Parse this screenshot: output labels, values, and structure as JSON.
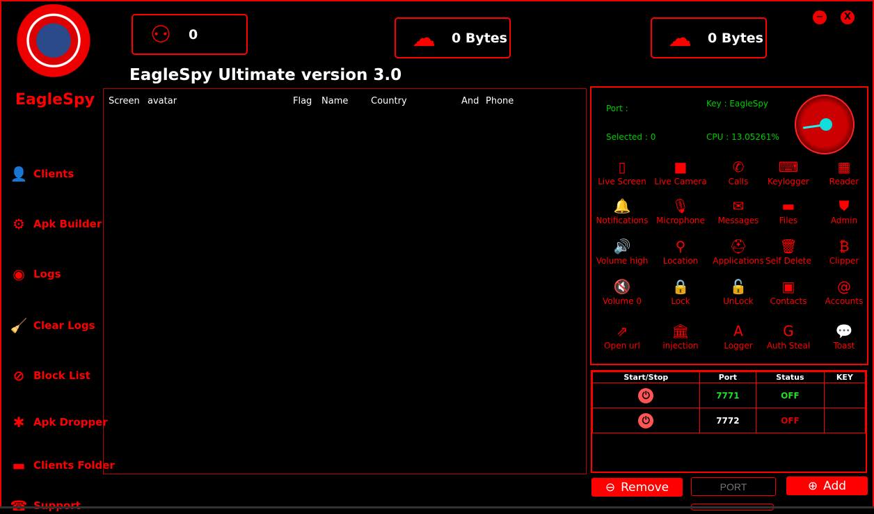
{
  "app": {
    "brand": "EagleSpy",
    "title": "EagleSpy Ultimate version 3.0"
  },
  "stats": [
    {
      "icon": "clients-network-icon",
      "value": "0"
    },
    {
      "icon": "cloud-upload-icon",
      "value": "0 Bytes"
    },
    {
      "icon": "cloud-download-icon",
      "value": "0 Bytes"
    }
  ],
  "window": {
    "minimize": "−",
    "close": "X"
  },
  "sidebar": [
    {
      "label": "Clients",
      "icon": "user-icon"
    },
    {
      "label": "Apk Builder",
      "icon": "builder-icon"
    },
    {
      "label": "Logs",
      "icon": "broadcast-icon"
    },
    {
      "label": "Clear Logs",
      "icon": "broom-icon"
    },
    {
      "label": "Block List",
      "icon": "user-block-icon"
    },
    {
      "label": "Apk Dropper",
      "icon": "bug-icon"
    },
    {
      "label": "Clients Folder",
      "icon": "folder-icon"
    },
    {
      "label": "Support",
      "icon": "support-icon"
    }
  ],
  "clients_table": {
    "columns": [
      "Screen",
      "avatar",
      "Flag",
      "Name",
      "Country",
      "And",
      "Phone"
    ]
  },
  "info": {
    "port": "Port :",
    "key": "Key : EagleSpy",
    "selected": "Selected : 0",
    "cpu": "CPU : 13.05261%",
    "cpu_percent": 13.05261
  },
  "commands": [
    {
      "label": "Live Screen",
      "icon": "tablet-icon"
    },
    {
      "label": "Live Camera",
      "icon": "video-camera-icon"
    },
    {
      "label": "Calls",
      "icon": "phone-icon"
    },
    {
      "label": "Keylogger",
      "icon": "keyboard-icon"
    },
    {
      "label": "Reader",
      "icon": "reader-icon"
    },
    {
      "label": "Notifications",
      "icon": "bell-icon"
    },
    {
      "label": "Microphone",
      "icon": "microphone-icon"
    },
    {
      "label": "Messages",
      "icon": "envelope-icon"
    },
    {
      "label": "Files",
      "icon": "folder-icon"
    },
    {
      "label": "Admin",
      "icon": "shield-icon"
    },
    {
      "label": "Volume high",
      "icon": "volume-high-icon"
    },
    {
      "label": "Location",
      "icon": "map-pin-icon"
    },
    {
      "label": "Applications",
      "icon": "android-icon"
    },
    {
      "label": "Self Delete",
      "icon": "trash-icon"
    },
    {
      "label": "Clipper",
      "icon": "bitcoin-icon"
    },
    {
      "label": "Volume 0",
      "icon": "volume-mute-icon"
    },
    {
      "label": "Lock",
      "icon": "lock-icon"
    },
    {
      "label": "UnLock",
      "icon": "unlock-icon"
    },
    {
      "label": "Contacts",
      "icon": "contacts-icon"
    },
    {
      "label": "Accounts",
      "icon": "at-icon"
    },
    {
      "label": "Open url",
      "icon": "external-link-icon"
    },
    {
      "label": "injection",
      "icon": "bank-icon"
    },
    {
      "label": "Logger",
      "icon": "logger-icon"
    },
    {
      "label": "Auth Steal",
      "icon": "google-icon"
    },
    {
      "label": "Toast",
      "icon": "chat-icon"
    }
  ],
  "ports_table": {
    "columns": [
      "Start/Stop",
      "Port",
      "Status",
      "KEY"
    ],
    "rows": [
      {
        "port": "7771",
        "status": "OFF",
        "port_color": "#22dd22",
        "status_color": "#22dd22",
        "key": ""
      },
      {
        "port": "7772",
        "status": "OFF",
        "port_color": "#ffffff",
        "status_color": "#dd0000",
        "key": ""
      }
    ]
  },
  "buttons": {
    "remove": "Remove",
    "port_placeholder": "PORT",
    "add": "Add"
  },
  "colors": {
    "accent": "#ff0000",
    "green": "#00cc00"
  }
}
